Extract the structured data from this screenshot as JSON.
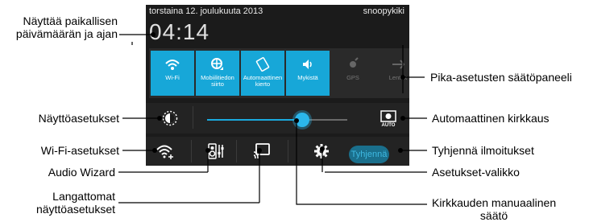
{
  "status_bar": {
    "date": "torstaina 12. joulukuuta 2013",
    "user": "snoopykiki"
  },
  "clock": "04:14",
  "quick_settings": {
    "tiles": [
      {
        "label": "Wi-Fi",
        "icon": "wifi-icon",
        "active": true
      },
      {
        "label": "Mobiilitiedon siirto",
        "icon": "mobile-data-icon",
        "active": true
      },
      {
        "label": "Automaattinen kierto",
        "icon": "auto-rotate-icon",
        "active": true
      },
      {
        "label": "Mykistä",
        "icon": "volume-icon",
        "active": true
      },
      {
        "label": "GPS",
        "icon": "gps-icon",
        "active": false
      },
      {
        "label": "Lentok",
        "icon": "airplane-icon",
        "active": false
      }
    ]
  },
  "brightness": {
    "level_percent": 68
  },
  "buttons": {
    "clear": "Tyhjennä"
  },
  "colors": {
    "accent": "#17a7d8",
    "panel": "#1b1b1b"
  },
  "callouts": {
    "date_time": [
      "Näyttää paikallisen",
      "päivämäärän ja ajan"
    ],
    "quick_panel": "Pika-asetusten säätöpaneeli",
    "display_settings": "Näyttöasetukset",
    "auto_brightness": "Automaattinen kirkkaus",
    "wifi_settings": "Wi-Fi-asetukset",
    "clear_notifications": "Tyhjennä ilmoitukset",
    "audio_wizard": "Audio Wizard",
    "settings_menu": "Asetukset-valikko",
    "wireless_display": [
      "Langattomat",
      "näyttöasetukset"
    ],
    "manual_brightness": [
      "Kirkkauden manuaalinen",
      "säätö"
    ]
  }
}
